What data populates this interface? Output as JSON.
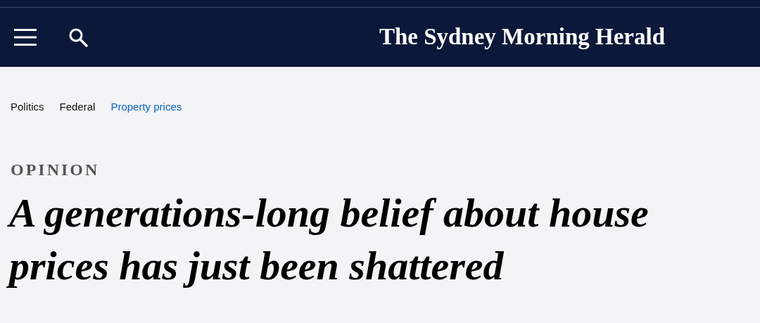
{
  "header": {
    "logo": "The Sydney Morning Herald"
  },
  "breadcrumbs": [
    {
      "label": "Politics",
      "color": "#111111"
    },
    {
      "label": "Federal",
      "color": "#111111"
    },
    {
      "label": "Property prices",
      "color": "#0a62c2"
    }
  ],
  "article": {
    "label": "OPINION",
    "headline": "A generations-long belief about house prices has just been shattered"
  }
}
